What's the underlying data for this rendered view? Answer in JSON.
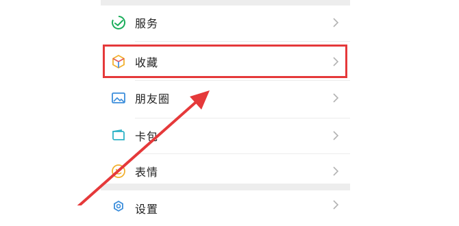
{
  "menu": {
    "items": [
      {
        "label": "服务",
        "icon": "service-check-icon"
      },
      {
        "label": "收藏",
        "icon": "favorites-cube-icon"
      },
      {
        "label": "朋友圈",
        "icon": "moments-image-icon"
      },
      {
        "label": "卡包",
        "icon": "wallet-card-icon"
      },
      {
        "label": "表情",
        "icon": "smiley-emoji-icon"
      }
    ],
    "bottom_item": {
      "label": "设置",
      "icon": "settings-gear-icon"
    }
  },
  "annotation": {
    "highlight_color": "#e5393a",
    "arrow_color": "#e5393a"
  }
}
